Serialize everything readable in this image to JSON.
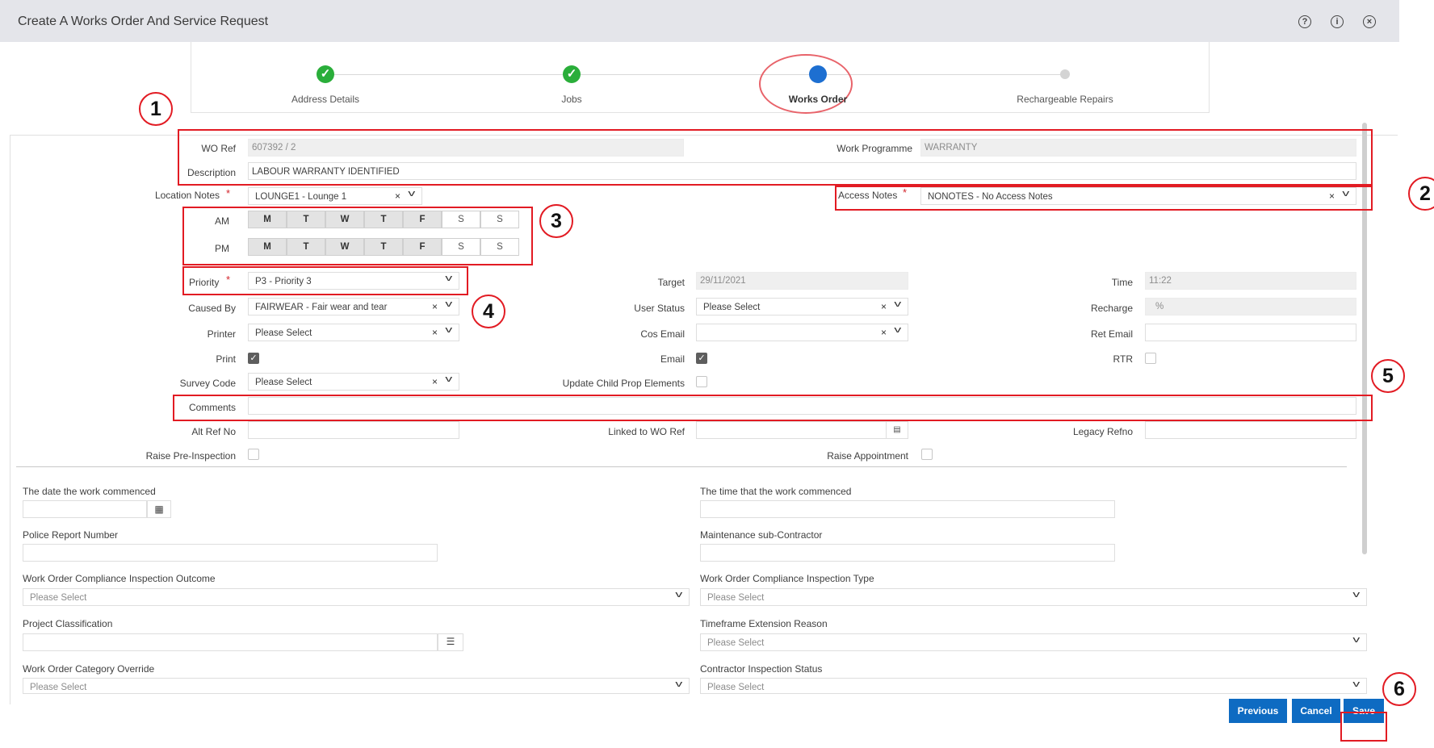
{
  "window": {
    "title": "Create A Works Order And Service Request",
    "help_icon": "question-icon",
    "info_icon": "info-icon",
    "close_icon": "close-icon"
  },
  "wizard": {
    "steps": [
      {
        "label": "Address Details",
        "state": "done"
      },
      {
        "label": "Jobs",
        "state": "done"
      },
      {
        "label": "Works Order",
        "state": "current"
      },
      {
        "label": "Rechargeable Repairs",
        "state": "upcoming"
      }
    ]
  },
  "form": {
    "wo_ref": {
      "label": "WO Ref",
      "value": "607392 / 2"
    },
    "work_programme": {
      "label": "Work Programme",
      "value": "WARRANTY"
    },
    "description": {
      "label": "Description",
      "value": "LABOUR WARRANTY IDENTIFIED"
    },
    "location_notes": {
      "label": "Location Notes",
      "value": "LOUNGE1 - Lounge 1"
    },
    "access_notes": {
      "label": "Access Notes",
      "value": "NONOTES - No Access Notes"
    },
    "am_label": "AM",
    "pm_label": "PM",
    "days": [
      "M",
      "T",
      "W",
      "T",
      "F",
      "S",
      "S"
    ],
    "days_selected": [
      true,
      true,
      true,
      true,
      true,
      false,
      false
    ],
    "priority": {
      "label": "Priority",
      "value": "P3 - Priority 3"
    },
    "target": {
      "label": "Target",
      "value": "29/11/2021"
    },
    "time": {
      "label": "Time",
      "value": "11:22"
    },
    "caused_by": {
      "label": "Caused By",
      "value": "FAIRWEAR - Fair wear and tear"
    },
    "user_status": {
      "label": "User Status",
      "value": "Please Select"
    },
    "recharge": {
      "label": "Recharge",
      "value": "%"
    },
    "printer": {
      "label": "Printer",
      "value": "Please Select"
    },
    "cos_email": {
      "label": "Cos Email",
      "value": ""
    },
    "ret_email": {
      "label": "Ret Email",
      "value": ""
    },
    "print": {
      "label": "Print",
      "checked": true
    },
    "email": {
      "label": "Email",
      "checked": true
    },
    "rtr": {
      "label": "RTR",
      "checked": false
    },
    "survey_code": {
      "label": "Survey Code",
      "value": "Please Select"
    },
    "update_child": {
      "label": "Update Child Prop Elements",
      "checked": false
    },
    "comments": {
      "label": "Comments",
      "value": ""
    },
    "alt_ref_no": {
      "label": "Alt Ref No",
      "value": ""
    },
    "linked_wo_ref": {
      "label": "Linked to WO Ref",
      "value": ""
    },
    "legacy_refno": {
      "label": "Legacy Refno",
      "value": ""
    },
    "raise_pre_inspection": {
      "label": "Raise Pre-Inspection",
      "checked": false
    },
    "raise_appointment": {
      "label": "Raise Appointment",
      "checked": false
    }
  },
  "extra": {
    "date_commenced": {
      "label": "The date the work commenced",
      "value": ""
    },
    "time_commenced": {
      "label": "The time that the work commenced",
      "value": ""
    },
    "police_report": {
      "label": "Police Report Number",
      "value": ""
    },
    "maintenance_sub": {
      "label": "Maintenance sub-Contractor",
      "value": ""
    },
    "compliance_outcome": {
      "label": "Work Order Compliance Inspection Outcome",
      "value": "Please Select"
    },
    "compliance_type": {
      "label": "Work Order Compliance Inspection Type",
      "value": "Please Select"
    },
    "project_classification": {
      "label": "Project Classification",
      "value": ""
    },
    "timeframe_extension": {
      "label": "Timeframe Extension Reason",
      "value": "Please Select"
    },
    "category_override": {
      "label": "Work Order Category Override",
      "value": "Please Select"
    },
    "contractor_inspection": {
      "label": "Contractor Inspection Status",
      "value": "Please Select"
    }
  },
  "buttons": {
    "previous": "Previous",
    "cancel": "Cancel",
    "save": "Save"
  },
  "annotations": [
    "1",
    "2",
    "3",
    "4",
    "5",
    "6"
  ],
  "colors": {
    "primary_button": "#0e6bc2",
    "annotation_red": "#e21b23",
    "step_done": "#2aae3a",
    "step_current": "#1d6fd1"
  }
}
